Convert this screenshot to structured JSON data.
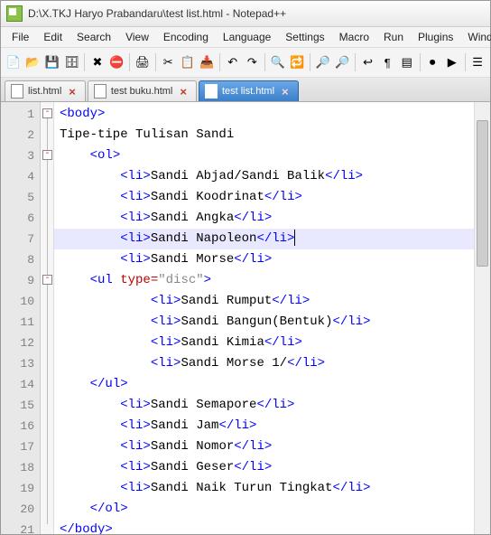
{
  "window": {
    "title": "D:\\X.TKJ Haryo Prabandaru\\test list.html - Notepad++"
  },
  "menu": [
    "File",
    "Edit",
    "Search",
    "View",
    "Encoding",
    "Language",
    "Settings",
    "Macro",
    "Run",
    "Plugins",
    "Window",
    "?"
  ],
  "toolbar_icons": [
    "new-file",
    "open-file",
    "save",
    "save-all",
    "|",
    "close",
    "close-all",
    "|",
    "print",
    "|",
    "cut",
    "copy",
    "paste",
    "|",
    "undo",
    "redo",
    "|",
    "find",
    "replace",
    "|",
    "zoom-in",
    "zoom-out",
    "|",
    "word-wrap",
    "show-all",
    "indent-guide",
    "|",
    "macro-rec",
    "macro-play",
    "|",
    "doc-map"
  ],
  "tabs": [
    {
      "label": "list.html",
      "active": false
    },
    {
      "label": "test buku.html",
      "active": false
    },
    {
      "label": "test list.html",
      "active": true
    }
  ],
  "editor": {
    "lines": [
      1,
      2,
      3,
      4,
      5,
      6,
      7,
      8,
      9,
      10,
      11,
      12,
      13,
      14,
      15,
      16,
      17,
      18,
      19,
      20,
      21
    ],
    "highlight_line": 7,
    "fold_markers": [
      {
        "line": 1,
        "type": "box"
      },
      {
        "line": 3,
        "type": "box"
      },
      {
        "line": 9,
        "type": "box"
      }
    ],
    "code_rows": [
      {
        "indent": 0,
        "segments": [
          {
            "c": "t-tag",
            "t": "<body>"
          }
        ]
      },
      {
        "indent": 0,
        "segments": [
          {
            "c": "t-text",
            "t": "Tipe-tipe Tulisan Sandi"
          }
        ]
      },
      {
        "indent": 1,
        "segments": [
          {
            "c": "t-tag",
            "t": "<ol>"
          }
        ]
      },
      {
        "indent": 2,
        "segments": [
          {
            "c": "t-tag",
            "t": "<li>"
          },
          {
            "c": "t-text",
            "t": "Sandi Abjad/Sandi Balik"
          },
          {
            "c": "t-tag",
            "t": "</li>"
          }
        ]
      },
      {
        "indent": 2,
        "segments": [
          {
            "c": "t-tag",
            "t": "<li>"
          },
          {
            "c": "t-text",
            "t": "Sandi Koodrinat"
          },
          {
            "c": "t-tag",
            "t": "</li>"
          }
        ]
      },
      {
        "indent": 2,
        "segments": [
          {
            "c": "t-tag",
            "t": "<li>"
          },
          {
            "c": "t-text",
            "t": "Sandi Angka"
          },
          {
            "c": "t-tag",
            "t": "</li>"
          }
        ]
      },
      {
        "indent": 2,
        "segments": [
          {
            "c": "t-tag",
            "t": "<li>"
          },
          {
            "c": "t-text",
            "t": "Sandi Napoleon"
          },
          {
            "c": "t-tag",
            "t": "</li>"
          }
        ],
        "caret": true
      },
      {
        "indent": 2,
        "segments": [
          {
            "c": "t-tag",
            "t": "<li>"
          },
          {
            "c": "t-text",
            "t": "Sandi Morse"
          },
          {
            "c": "t-tag",
            "t": "</li>"
          }
        ]
      },
      {
        "indent": 1,
        "segments": [
          {
            "c": "t-tag",
            "t": "<ul "
          },
          {
            "c": "t-attr",
            "t": "type="
          },
          {
            "c": "t-str",
            "t": "\"disc\""
          },
          {
            "c": "t-tag",
            "t": ">"
          }
        ]
      },
      {
        "indent": 3,
        "segments": [
          {
            "c": "t-tag",
            "t": "<li>"
          },
          {
            "c": "t-text",
            "t": "Sandi Rumput"
          },
          {
            "c": "t-tag",
            "t": "</li>"
          }
        ]
      },
      {
        "indent": 3,
        "segments": [
          {
            "c": "t-tag",
            "t": "<li>"
          },
          {
            "c": "t-text",
            "t": "Sandi Bangun(Bentuk)"
          },
          {
            "c": "t-tag",
            "t": "</li>"
          }
        ]
      },
      {
        "indent": 3,
        "segments": [
          {
            "c": "t-tag",
            "t": "<li>"
          },
          {
            "c": "t-text",
            "t": "Sandi Kimia"
          },
          {
            "c": "t-tag",
            "t": "</li>"
          }
        ]
      },
      {
        "indent": 3,
        "segments": [
          {
            "c": "t-tag",
            "t": "<li>"
          },
          {
            "c": "t-text",
            "t": "Sandi Morse 1/"
          },
          {
            "c": "t-tag",
            "t": "</li>"
          }
        ]
      },
      {
        "indent": 1,
        "segments": [
          {
            "c": "t-tag",
            "t": "</ul>"
          }
        ]
      },
      {
        "indent": 2,
        "segments": [
          {
            "c": "t-tag",
            "t": "<li>"
          },
          {
            "c": "t-text",
            "t": "Sandi Semapore"
          },
          {
            "c": "t-tag",
            "t": "</li>"
          }
        ]
      },
      {
        "indent": 2,
        "segments": [
          {
            "c": "t-tag",
            "t": "<li>"
          },
          {
            "c": "t-text",
            "t": "Sandi Jam"
          },
          {
            "c": "t-tag",
            "t": "</li>"
          }
        ]
      },
      {
        "indent": 2,
        "segments": [
          {
            "c": "t-tag",
            "t": "<li>"
          },
          {
            "c": "t-text",
            "t": "Sandi Nomor"
          },
          {
            "c": "t-tag",
            "t": "</li>"
          }
        ]
      },
      {
        "indent": 2,
        "segments": [
          {
            "c": "t-tag",
            "t": "<li>"
          },
          {
            "c": "t-text",
            "t": "Sandi Geser"
          },
          {
            "c": "t-tag",
            "t": "</li>"
          }
        ]
      },
      {
        "indent": 2,
        "segments": [
          {
            "c": "t-tag",
            "t": "<li>"
          },
          {
            "c": "t-text",
            "t": "Sandi Naik Turun Tingkat"
          },
          {
            "c": "t-tag",
            "t": "</li>"
          }
        ]
      },
      {
        "indent": 1,
        "segments": [
          {
            "c": "t-tag",
            "t": "</ol>"
          }
        ]
      },
      {
        "indent": 0,
        "segments": [
          {
            "c": "t-tag",
            "t": "</body>"
          }
        ]
      }
    ]
  },
  "icon_glyphs": {
    "new-file": "📄",
    "open-file": "📂",
    "save": "💾",
    "save-all": "🗄",
    "close": "✖",
    "close-all": "⛔",
    "print": "🖨",
    "cut": "✂",
    "copy": "📋",
    "paste": "📥",
    "undo": "↶",
    "redo": "↷",
    "find": "🔍",
    "replace": "🔁",
    "zoom-in": "🔎",
    "zoom-out": "🔎",
    "word-wrap": "↩",
    "show-all": "¶",
    "indent-guide": "▤",
    "macro-rec": "⏺",
    "macro-play": "▶",
    "doc-map": "☰"
  }
}
